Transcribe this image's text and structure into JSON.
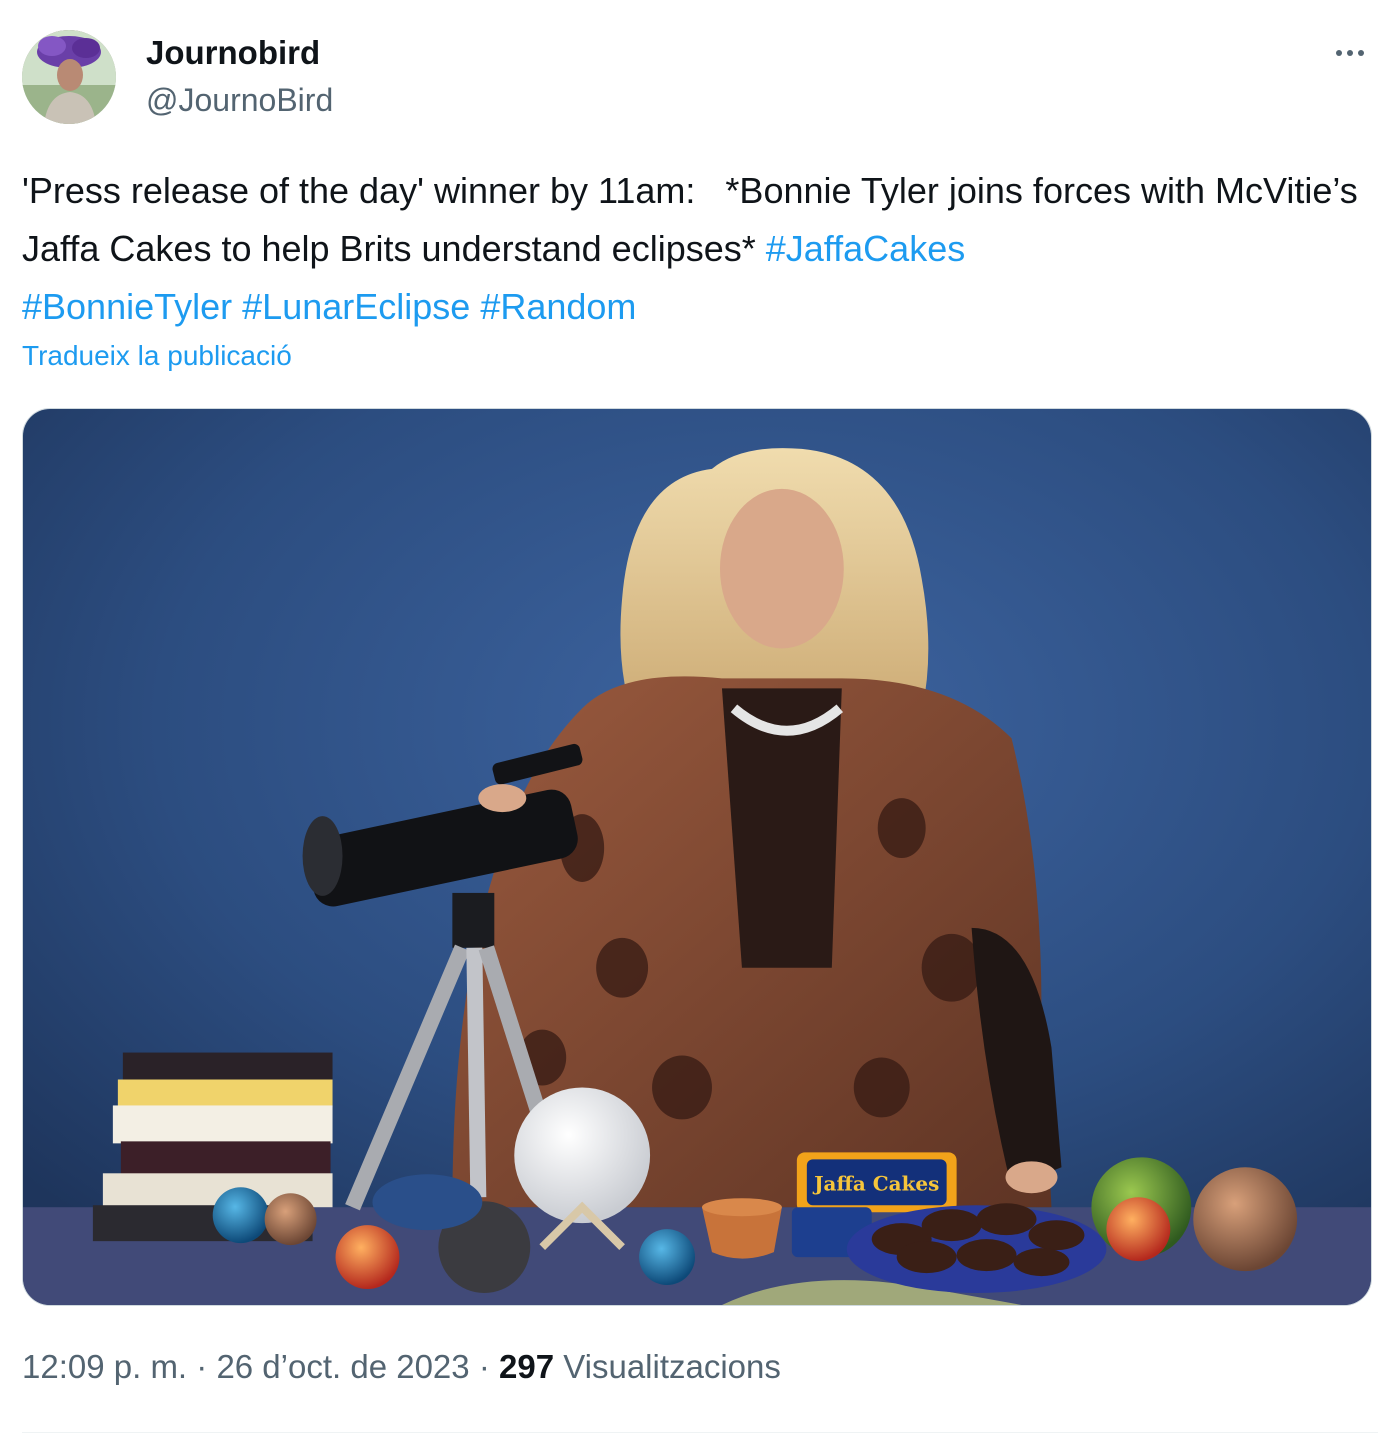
{
  "author": {
    "display_name": "Journobird",
    "handle": "@JournoBird"
  },
  "tweet": {
    "text_plain": "'Press release of the day' winner by 11am:   *Bonnie Tyler joins forces with McVitie’s Jaffa Cakes to help Brits understand eclipses* ",
    "hashtags": [
      "#JaffaCakes",
      "#BonnieTyler",
      "#LunarEclipse",
      "#Random"
    ],
    "translate_label": "Tradueix la publicació"
  },
  "media": {
    "package_text": "Jaffa Cakes"
  },
  "meta": {
    "time": "12:09 p. m.",
    "separator": " · ",
    "date": "26 d’oct. de 2023",
    "views_count": "297",
    "views_label": "Visualitzacions"
  },
  "colors": {
    "link": "#1d9bf0",
    "text": "#0f1419",
    "secondary": "#536471",
    "backdrop": "#2f4f7f"
  },
  "icons": [
    "more-options-icon"
  ]
}
